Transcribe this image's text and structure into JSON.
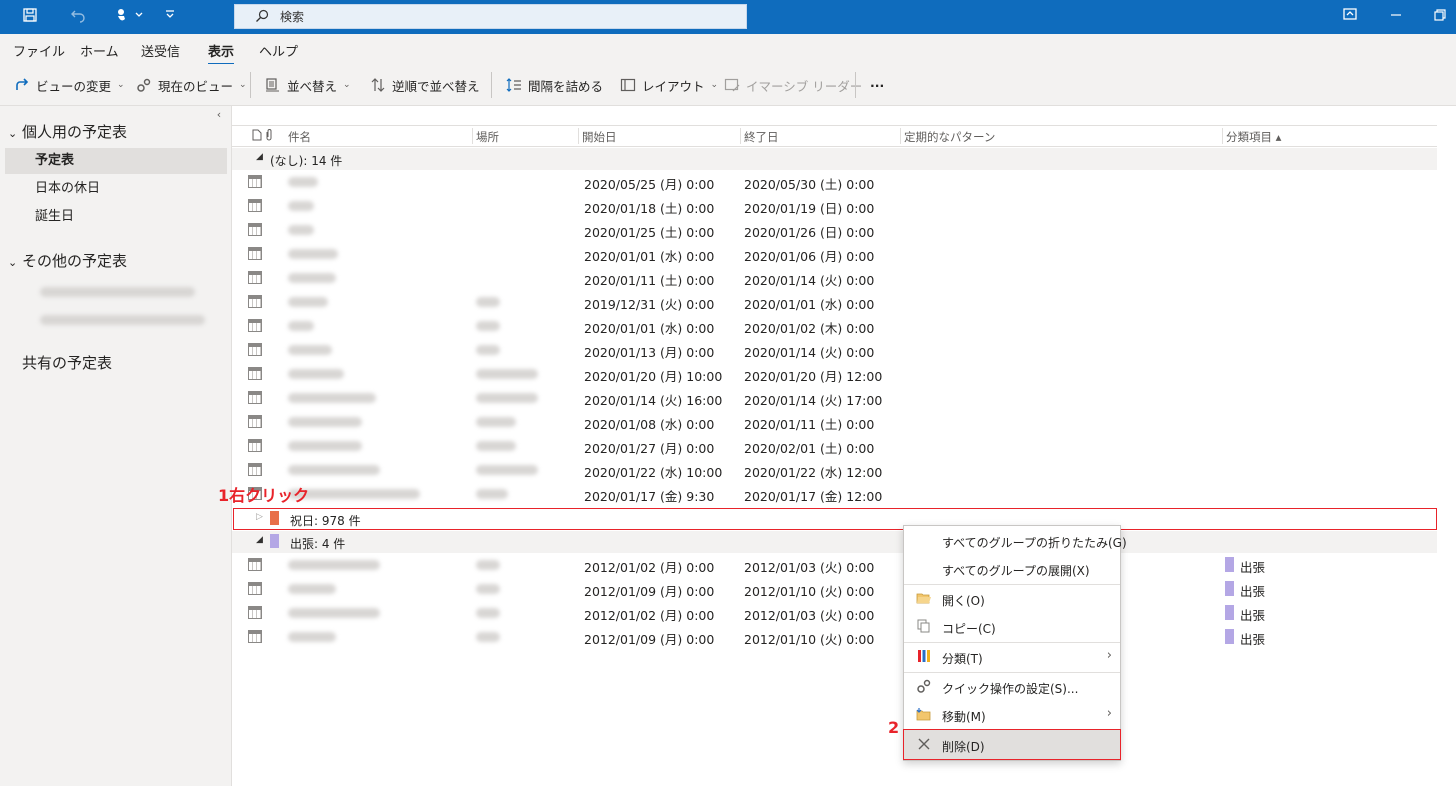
{
  "titlebar": {
    "search_placeholder": "検索"
  },
  "menu": {
    "tabs": [
      "ファイル",
      "ホーム",
      "送受信",
      "表示",
      "ヘルプ"
    ],
    "active_tab": "表示"
  },
  "ribbon": {
    "change_view": "ビューの変更",
    "view_settings": "現在のビュー",
    "arrange": "並べ替え",
    "reverse_sort": "逆順で並べ替え",
    "tighten_spacing": "間隔を詰める",
    "layout": "レイアウト",
    "immersive_reader": "イマーシブ リーダー",
    "more": "···"
  },
  "sidebar": {
    "my_calendars": "個人用の予定表",
    "items": [
      "予定表",
      "日本の休日",
      "誕生日"
    ],
    "other_calendars": "その他の予定表",
    "shared_calendars": "共有の予定表"
  },
  "table": {
    "columns": [
      "件名",
      "場所",
      "開始日",
      "終了日",
      "定期的なパターン",
      "分類項目 ▴"
    ],
    "groups": {
      "none": "(なし): 14 件",
      "holiday": "祝日: 978 件",
      "trip": "出張: 4 件"
    },
    "none_rows": [
      {
        "start": "2020/05/25 (月) 0:00",
        "end": "2020/05/30 (土) 0:00"
      },
      {
        "start": "2020/01/18 (土) 0:00",
        "end": "2020/01/19 (日) 0:00"
      },
      {
        "start": "2020/01/25 (土) 0:00",
        "end": "2020/01/26 (日) 0:00"
      },
      {
        "start": "2020/01/01 (水) 0:00",
        "end": "2020/01/06 (月) 0:00"
      },
      {
        "start": "2020/01/11 (土) 0:00",
        "end": "2020/01/14 (火) 0:00"
      },
      {
        "start": "2019/12/31 (火) 0:00",
        "end": "2020/01/01 (水) 0:00"
      },
      {
        "start": "2020/01/01 (水) 0:00",
        "end": "2020/01/02 (木) 0:00"
      },
      {
        "start": "2020/01/13 (月) 0:00",
        "end": "2020/01/14 (火) 0:00"
      },
      {
        "start": "2020/01/20 (月) 10:00",
        "end": "2020/01/20 (月) 12:00"
      },
      {
        "start": "2020/01/14 (火) 16:00",
        "end": "2020/01/14 (火) 17:00"
      },
      {
        "start": "2020/01/08 (水) 0:00",
        "end": "2020/01/11 (土) 0:00"
      },
      {
        "start": "2020/01/27 (月) 0:00",
        "end": "2020/02/01 (土) 0:00"
      },
      {
        "start": "2020/01/22 (水) 10:00",
        "end": "2020/01/22 (水) 12:00"
      },
      {
        "start": "2020/01/17 (金) 9:30",
        "end": "2020/01/17 (金) 12:00"
      }
    ],
    "trip_rows": [
      {
        "start": "2012/01/02 (月) 0:00",
        "end": "2012/01/03 (火) 0:00",
        "category": "出張"
      },
      {
        "start": "2012/01/09 (月) 0:00",
        "end": "2012/01/10 (火) 0:00",
        "category": "出張"
      },
      {
        "start": "2012/01/02 (月) 0:00",
        "end": "2012/01/03 (火) 0:00",
        "category": "出張"
      },
      {
        "start": "2012/01/09 (月) 0:00",
        "end": "2012/01/10 (火) 0:00",
        "category": "出張"
      }
    ]
  },
  "annotations": {
    "step1": "1右クリック",
    "step2": "2"
  },
  "context_menu": {
    "collapse_all": "すべてのグループの折りたたみ(G)",
    "expand_all": "すべてのグループの展開(X)",
    "open": "開く(O)",
    "copy": "コピー(C)",
    "categorize": "分類(T)",
    "quick_steps": "クイック操作の設定(S)...",
    "move": "移動(M)",
    "delete": "削除(D)"
  },
  "colors": {
    "titlebar": "#0f6cbd",
    "holiday_category": "#e8704a",
    "trip_category": "#b4a7e5",
    "annotation_red": "#e8232a"
  }
}
